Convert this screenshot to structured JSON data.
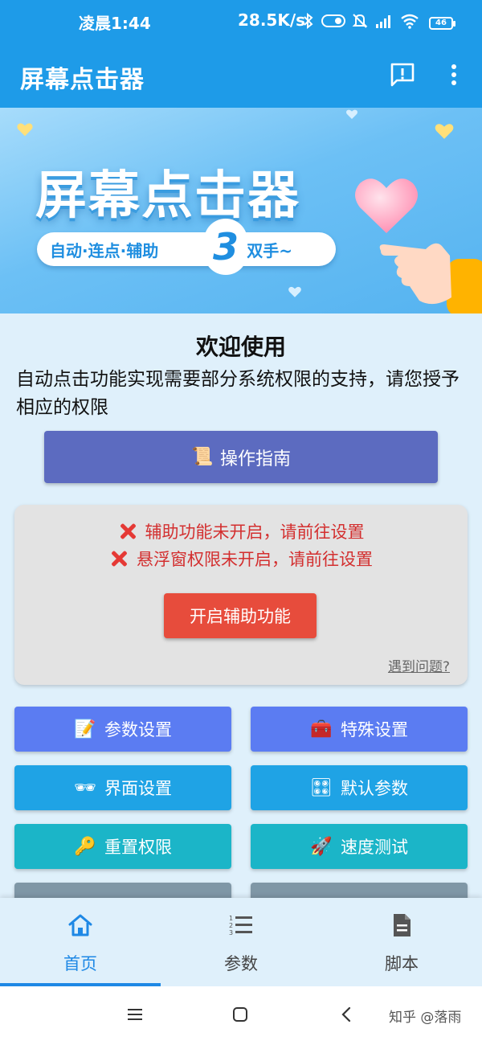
{
  "status_bar": {
    "time": "凌晨1:44",
    "net_rate": "28.5K/s",
    "battery": "46",
    "icons": [
      "bluetooth-icon",
      "toggle-icon",
      "mute-icon",
      "hd-signal-icon",
      "wifi-icon",
      "battery-icon"
    ]
  },
  "app_bar": {
    "title": "屏幕点击器",
    "icons": [
      "feedback-icon",
      "more-vert-icon"
    ]
  },
  "banner": {
    "title": "屏幕点击器",
    "tagline_left": "自动·连点·辅助",
    "number": "3",
    "tagline_right": "解放双手~"
  },
  "welcome": {
    "title": "欢迎使用",
    "description": "自动点击功能实现需要部分系统权限的支持，请您授予相应的权限"
  },
  "guide_button": {
    "icon": "📜",
    "label": "操作指南"
  },
  "warning_card": {
    "warnings": [
      "辅助功能未开启，请前往设置",
      "悬浮窗权限未开启，请前往设置"
    ],
    "enable_button": "开启辅助功能",
    "problem_link": "遇到问题?"
  },
  "grid_buttons": [
    {
      "icon": "📝",
      "label": "参数设置"
    },
    {
      "icon": "🧰",
      "label": "特殊设置"
    },
    {
      "icon": "🕶",
      "label": "界面设置"
    },
    {
      "icon": "🎛",
      "label": "默认参数"
    },
    {
      "icon": "🔑",
      "label": "重置权限"
    },
    {
      "icon": "🚀",
      "label": "速度测试"
    }
  ],
  "bottom_nav": [
    {
      "label": "首页",
      "icon": "home-icon",
      "active": true
    },
    {
      "label": "参数",
      "icon": "list-numbered-icon",
      "active": false
    },
    {
      "label": "脚本",
      "icon": "document-icon",
      "active": false
    }
  ],
  "system_nav": {
    "icons": [
      "menu-icon",
      "home-square-icon",
      "back-icon"
    ],
    "watermark": "知乎 @落雨"
  },
  "colors": {
    "primary": "#1e9be8",
    "guide": "#5c6bc0",
    "danger": "#e74c3c",
    "active_tab": "#1e88e5"
  }
}
